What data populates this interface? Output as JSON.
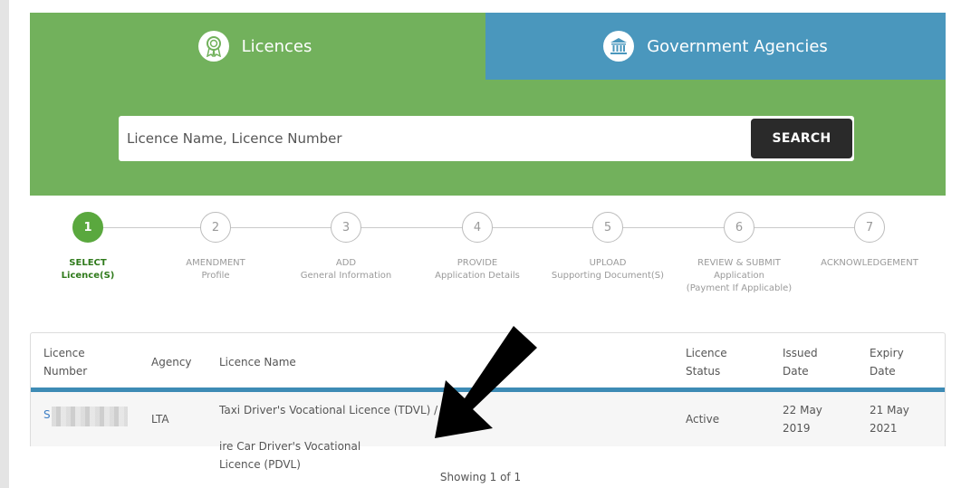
{
  "tabs": {
    "licences": {
      "label": "Licences",
      "icon": "ribbon-icon"
    },
    "agencies": {
      "label": "Government Agencies",
      "icon": "bank-icon"
    }
  },
  "search": {
    "placeholder": "Licence Name, Licence Number",
    "value": "",
    "button_label": "SEARCH"
  },
  "steps": [
    {
      "number": "1",
      "line1": "SELECT",
      "line2": "Licence(S)",
      "line3": "",
      "active": true
    },
    {
      "number": "2",
      "line1": "AMENDMENT",
      "line2": "Profile",
      "line3": ""
    },
    {
      "number": "3",
      "line1": "ADD",
      "line2": "General Information",
      "line3": ""
    },
    {
      "number": "4",
      "line1": "PROVIDE",
      "line2": "Application Details",
      "line3": ""
    },
    {
      "number": "5",
      "line1": "UPLOAD",
      "line2": "Supporting Document(S)",
      "line3": ""
    },
    {
      "number": "6",
      "line1": "REVIEW & SUBMIT",
      "line2": "Application",
      "line3": "(Payment If Applicable)"
    },
    {
      "number": "7",
      "line1": "ACKNOWLEDGEMENT",
      "line2": "",
      "line3": ""
    }
  ],
  "table": {
    "headers": {
      "licence_number": {
        "line1": "Licence",
        "line2": "Number"
      },
      "agency": {
        "line1": "Agency",
        "line2": ""
      },
      "licence_name": {
        "line1": "Licence Name",
        "line2": ""
      },
      "licence_status": {
        "line1": "Licence",
        "line2": "Status"
      },
      "issued_date": {
        "line1": "Issued",
        "line2": "Date"
      },
      "expiry_date": {
        "line1": "Expiry",
        "line2": "Date"
      }
    },
    "rows": [
      {
        "licence_number_prefix": "S",
        "agency": "LTA",
        "licence_name_line1": "Taxi Driver's Vocational Licence (TDVL) / P",
        "licence_name_line1b": "ire Car Driver's Vocational",
        "licence_name_line2": "Licence (PDVL)",
        "status": "Active",
        "issued_line1": "22 May",
        "issued_line2": "2019",
        "expiry_line1": "21 May",
        "expiry_line2": "2021"
      }
    ]
  },
  "pagination": {
    "text": "Showing 1 of 1"
  },
  "colors": {
    "green": "#72b15c",
    "blue": "#4a97bd",
    "active_step": "#5aa83e",
    "dark_button": "#2a2a2a"
  }
}
